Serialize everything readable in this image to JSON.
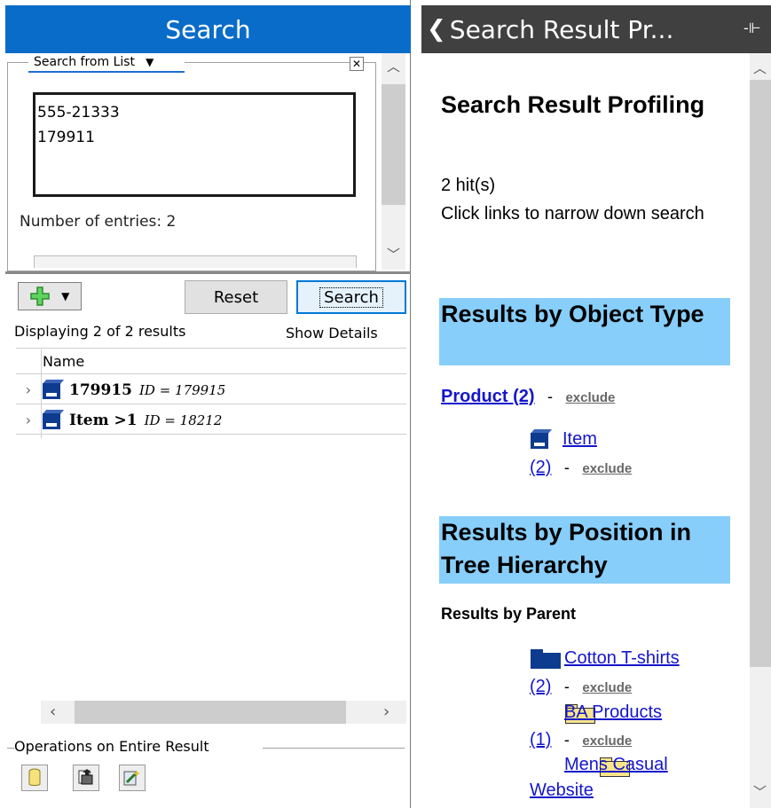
{
  "left": {
    "title": "Search",
    "search_mode": "Search from List",
    "entries": [
      "555-21333",
      "179911"
    ],
    "entries_count": "Number of entries: 2",
    "reset_label": "Reset",
    "search_label": "Search",
    "displaying": "Displaying 2 of 2 results",
    "show_details": "Show Details",
    "column_name": "Name",
    "rows": [
      {
        "name": "179915",
        "id": "ID = 179915"
      },
      {
        "name": "Item >1",
        "id": "ID = 18212"
      }
    ],
    "ops_label": "Operations on Entire Result"
  },
  "right": {
    "header": "Search Result Pr...",
    "title": "Search Result Profiling",
    "hits": "2 hit(s)",
    "hint": "Click links to narrow down search",
    "section_type": "Results by Object Type",
    "product_link": "Product (2)",
    "exclude": "exclude",
    "item_link": "Item",
    "item_count": "(2)",
    "section_position": "Results by Position in Tree Hierarchy",
    "by_parent": "Results by Parent",
    "parents": [
      {
        "name": "Cotton T-shirts",
        "count": "(2)"
      },
      {
        "name": "BA Products",
        "count": "(1)"
      },
      {
        "name": "Mens Casual",
        "cont": "Website"
      }
    ]
  },
  "colors": {
    "title_bar": "#0a6cc9",
    "header_bar": "#404040",
    "band": "#87cefa",
    "link": "#1515cc"
  }
}
